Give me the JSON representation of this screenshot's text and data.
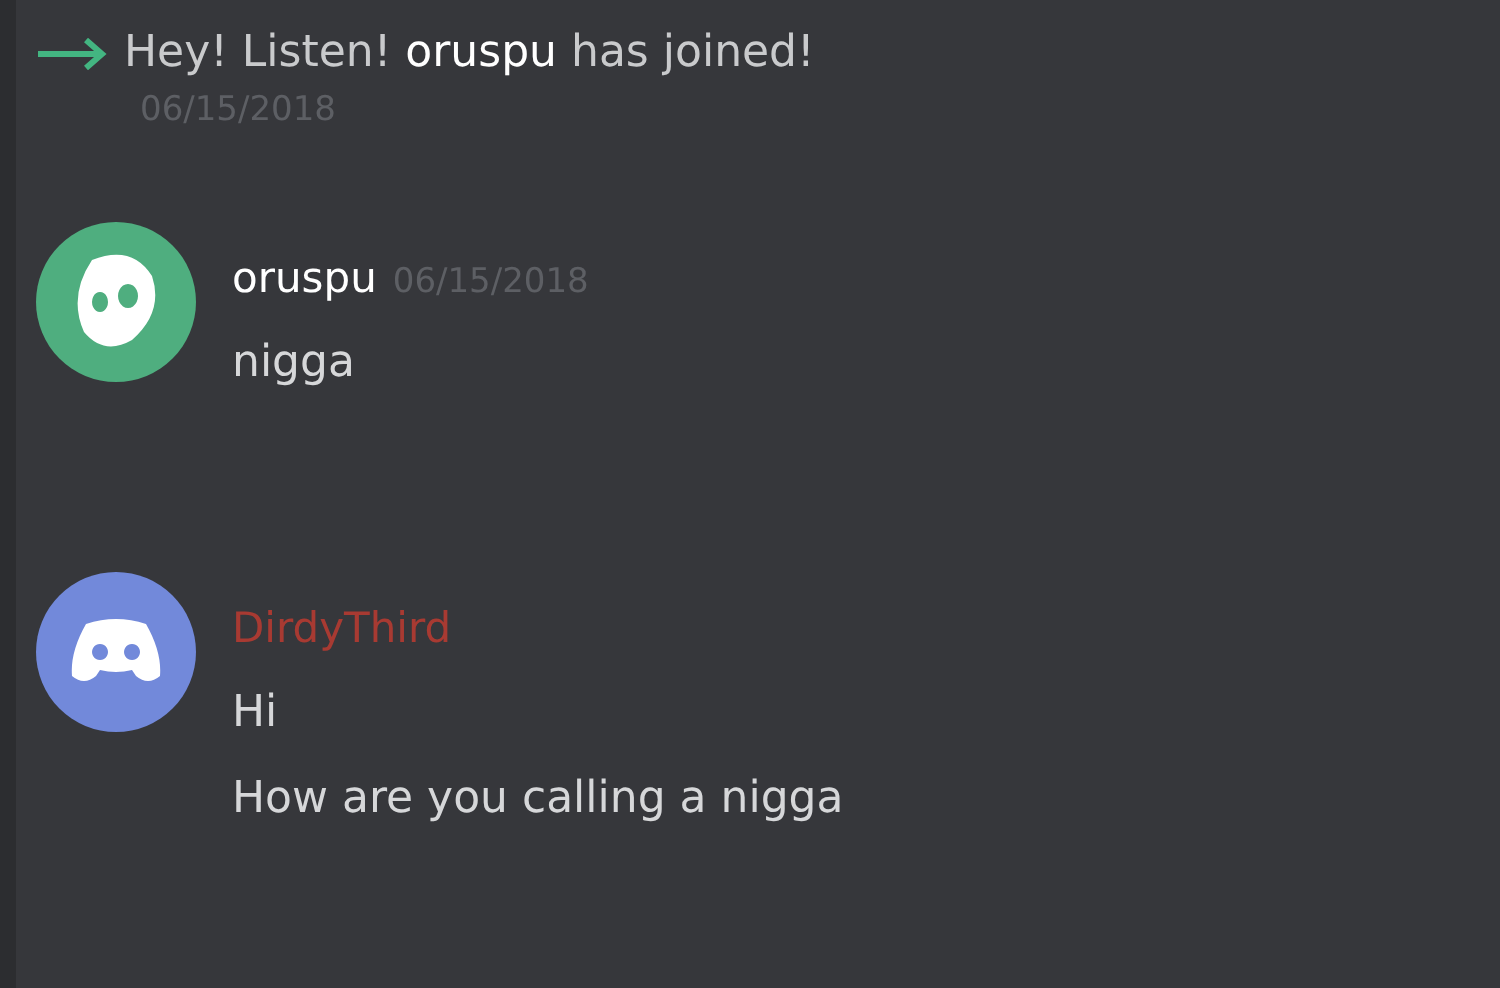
{
  "system_message": {
    "prefix": "Hey! Listen!",
    "username": "oruspu",
    "suffix": "has joined!",
    "timestamp": "06/15/2018"
  },
  "messages": [
    {
      "author": "oruspu",
      "timestamp": "06/15/2018",
      "color": "#ffffff",
      "avatar": {
        "kind": "custom",
        "color": "#4fae7f"
      },
      "lines": [
        "nigga"
      ]
    },
    {
      "author": "DirdyThird",
      "color": "#a83a32",
      "avatar": {
        "kind": "default",
        "color": "#7289da"
      },
      "lines": [
        "Hi",
        "How are you calling a nigga"
      ]
    }
  ]
}
